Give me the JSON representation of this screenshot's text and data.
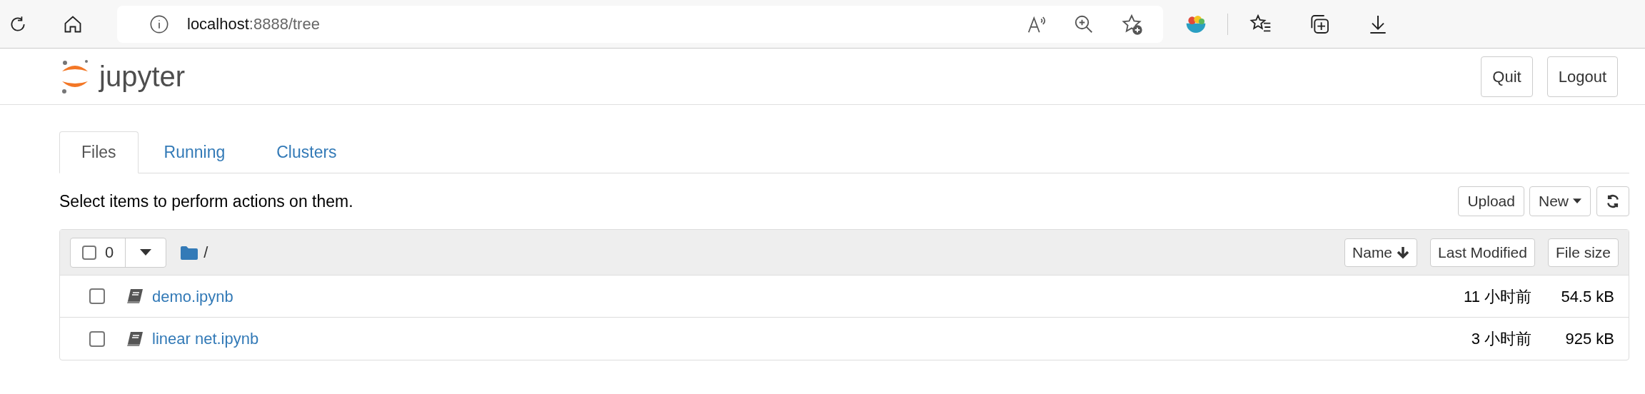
{
  "browser": {
    "address_host": "localhost",
    "address_path": ":8888/tree"
  },
  "header": {
    "logo_text": "jupyter",
    "buttons": [
      "Quit",
      "Logout"
    ]
  },
  "tabs": [
    {
      "label": "Files",
      "selected": true
    },
    {
      "label": "Running",
      "selected": false
    },
    {
      "label": "Clusters",
      "selected": false
    }
  ],
  "hint": "Select items to perform actions on them.",
  "toolbar": {
    "buttons": [
      "Upload",
      "New"
    ]
  },
  "list_header": {
    "all_checked": false,
    "selected_count": "0",
    "path": "/",
    "sort_buttons": [
      "Name",
      "Last Modified",
      "File size"
    ]
  },
  "files": [
    {
      "name": "demo.ipynb",
      "modified": "11 小时前",
      "size": "54.5 kB",
      "checked": false
    },
    {
      "name": "linear net.ipynb",
      "modified": "3 小时前",
      "size": "925 kB",
      "checked": false
    }
  ]
}
